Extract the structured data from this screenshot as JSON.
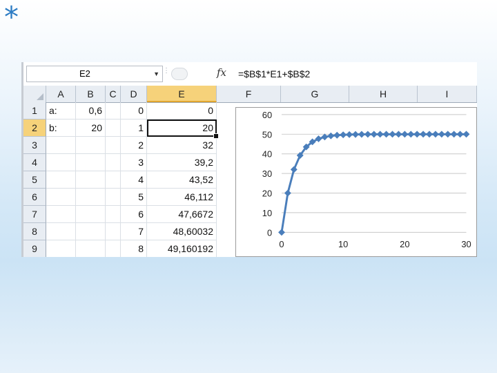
{
  "decoration": {
    "corner_star": "*"
  },
  "formula_bar": {
    "name_box": "E2",
    "name_box_arrow": "▼",
    "fx_label": "fx",
    "formula": "=$B$1*E1+$B$2"
  },
  "columns": [
    "A",
    "B",
    "C",
    "D",
    "E",
    "F",
    "G",
    "H",
    "I"
  ],
  "selected_column": "E",
  "rows": [
    {
      "n": "1",
      "A": "a:",
      "B": "0,6",
      "D": "0",
      "E": "0"
    },
    {
      "n": "2",
      "A": "b:",
      "B": "20",
      "D": "1",
      "E": "20"
    },
    {
      "n": "3",
      "A": "",
      "B": "",
      "D": "2",
      "E": "32"
    },
    {
      "n": "4",
      "A": "",
      "B": "",
      "D": "3",
      "E": "39,2"
    },
    {
      "n": "5",
      "A": "",
      "B": "",
      "D": "4",
      "E": "43,52"
    },
    {
      "n": "6",
      "A": "",
      "B": "",
      "D": "5",
      "E": "46,112"
    },
    {
      "n": "7",
      "A": "",
      "B": "",
      "D": "6",
      "E": "47,6672"
    },
    {
      "n": "8",
      "A": "",
      "B": "",
      "D": "7",
      "E": "48,60032"
    },
    {
      "n": "9",
      "A": "",
      "B": "",
      "D": "8",
      "E": "49,160192"
    }
  ],
  "selected_row": "2",
  "colors": {
    "series": "#4a7ebb",
    "selection": "#f6d27a"
  },
  "chart_data": {
    "type": "line",
    "title": "",
    "xlabel": "",
    "ylabel": "",
    "xlim": [
      0,
      30
    ],
    "ylim": [
      0,
      60
    ],
    "x_ticks": [
      "0",
      "10",
      "20",
      "30"
    ],
    "y_ticks": [
      "0",
      "10",
      "20",
      "30",
      "40",
      "50",
      "60"
    ],
    "grid": "horizontal",
    "legend": "none",
    "marker": "diamond",
    "x": [
      0,
      1,
      2,
      3,
      4,
      5,
      6,
      7,
      8,
      9,
      10,
      11,
      12,
      13,
      14,
      15,
      16,
      17,
      18,
      19,
      20,
      21,
      22,
      23,
      24,
      25,
      26,
      27,
      28,
      29,
      30
    ],
    "values": [
      0,
      20,
      32,
      39.2,
      43.52,
      46.112,
      47.6672,
      48.60032,
      49.160192,
      49.4961,
      49.6977,
      49.8186,
      49.8912,
      49.9347,
      49.9608,
      49.9765,
      49.9859,
      49.9915,
      49.9949,
      49.997,
      49.9982,
      49.9989,
      49.9993,
      49.9996,
      49.9998,
      49.9999,
      49.9999,
      50,
      50,
      50,
      50
    ]
  }
}
